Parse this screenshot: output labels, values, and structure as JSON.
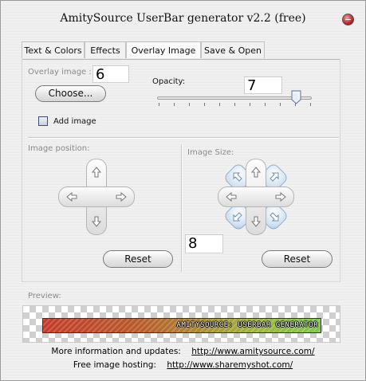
{
  "window": {
    "title": "AmitySource UserBar generator v2.2 (free)"
  },
  "tabs": [
    {
      "label": "Text & Colors",
      "active": false
    },
    {
      "label": "Effects",
      "active": false
    },
    {
      "label": "Overlay Image",
      "active": true
    },
    {
      "label": "Save & Open",
      "active": false
    }
  ],
  "overlay": {
    "label": "Overlay image :",
    "value": "6",
    "choose_button": "Choose...",
    "opacity_label": "Opacity:",
    "opacity_value": "7",
    "add_image_label": "Add image",
    "add_image_checked": false
  },
  "position": {
    "label": "Image position:",
    "reset_button": "Reset"
  },
  "size": {
    "label": "Image Size:",
    "value": "8",
    "reset_button": "Reset"
  },
  "preview": {
    "label": "Preview:",
    "userbar_text": "AMITYSOURCE: USERBAR GENERATOR"
  },
  "footer": {
    "info_text": "More information and updates:",
    "info_link": "http://www.amitysource.com/",
    "hosting_text": "Free image hosting:",
    "hosting_link": "http://www.sharemyshot.com/"
  },
  "colors": {
    "dpad_arm": "#e6e6e6",
    "diag_button": "#cfe0f0",
    "close_button": "#b51d1d"
  }
}
